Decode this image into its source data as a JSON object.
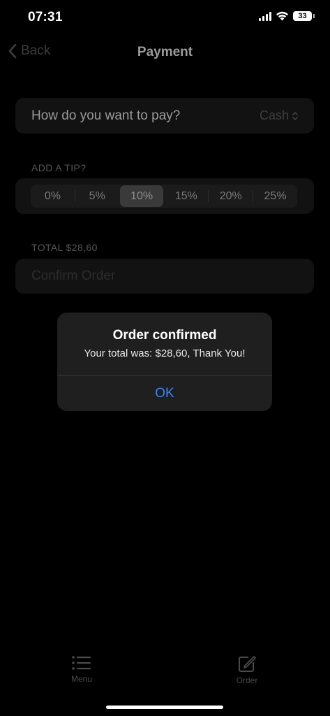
{
  "status": {
    "time": "07:31",
    "battery": "33"
  },
  "nav": {
    "back_label": "Back",
    "title": "Payment"
  },
  "payment": {
    "question": "How do you want to pay?",
    "method": "Cash"
  },
  "tip": {
    "section_label": "ADD A TIP?",
    "options": [
      "0%",
      "5%",
      "10%",
      "15%",
      "20%",
      "25%"
    ],
    "selected": "10%"
  },
  "total": {
    "label": "TOTAL $28,60"
  },
  "confirm": {
    "label": "Confirm Order"
  },
  "alert": {
    "title": "Order confirmed",
    "message": "Your total was: $28,60, Thank You!",
    "ok_label": "OK"
  },
  "tabbar": {
    "menu_label": "Menu",
    "order_label": "Order"
  },
  "colors": {
    "accent": "#3b82f6",
    "background": "#000000"
  }
}
